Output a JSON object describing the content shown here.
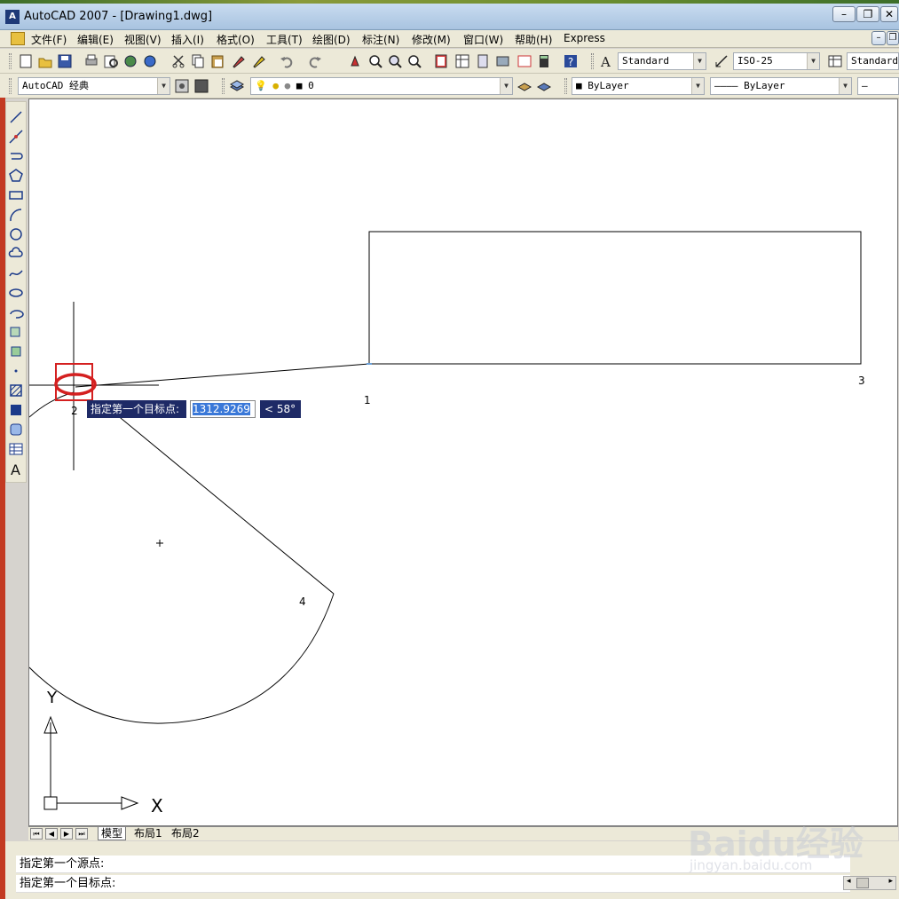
{
  "window": {
    "title": "AutoCAD 2007 - [Drawing1.dwg]",
    "app_icon_text": "A",
    "minimize": "–",
    "restore": "❐",
    "close": "✕"
  },
  "menu": {
    "items": [
      "文件(F)",
      "编辑(E)",
      "视图(V)",
      "插入(I)",
      "格式(O)",
      "工具(T)",
      "绘图(D)",
      "标注(N)",
      "修改(M)",
      "窗口(W)",
      "帮助(H)",
      "Express"
    ],
    "doc_min": "–",
    "doc_restore": "❐"
  },
  "toolbar_standard": {
    "text_style": "Standard",
    "dim_style": "ISO-25",
    "table_style": "Standard"
  },
  "toolbar_layers": {
    "workspace": "AutoCAD 经典",
    "layer": "0",
    "color": "ByLayer",
    "linetype": "ByLayer",
    "lineweight": "—"
  },
  "drawing": {
    "point_labels": [
      "1",
      "2",
      "3",
      "4"
    ]
  },
  "dynamic_input": {
    "prompt": "指定第一个目标点:",
    "value": "1312.9269",
    "angle": "< 58°"
  },
  "ucs": {
    "x_label": "X",
    "y_label": "Y"
  },
  "layout_tabs": {
    "nav": [
      "⏮",
      "◀",
      "▶",
      "⏭"
    ],
    "tabs": [
      "模型",
      "布局1",
      "布局2"
    ]
  },
  "command_line": {
    "line1": "指定第一个源点:",
    "line2": "指定第一个目标点:"
  },
  "watermark": {
    "main": "Baidu经验",
    "sub": "jingyan.baidu.com"
  },
  "colors": {
    "highlight_red": "#d42020",
    "prompt_bg": "#1e2a66",
    "selection_blue": "#3a78d8"
  }
}
